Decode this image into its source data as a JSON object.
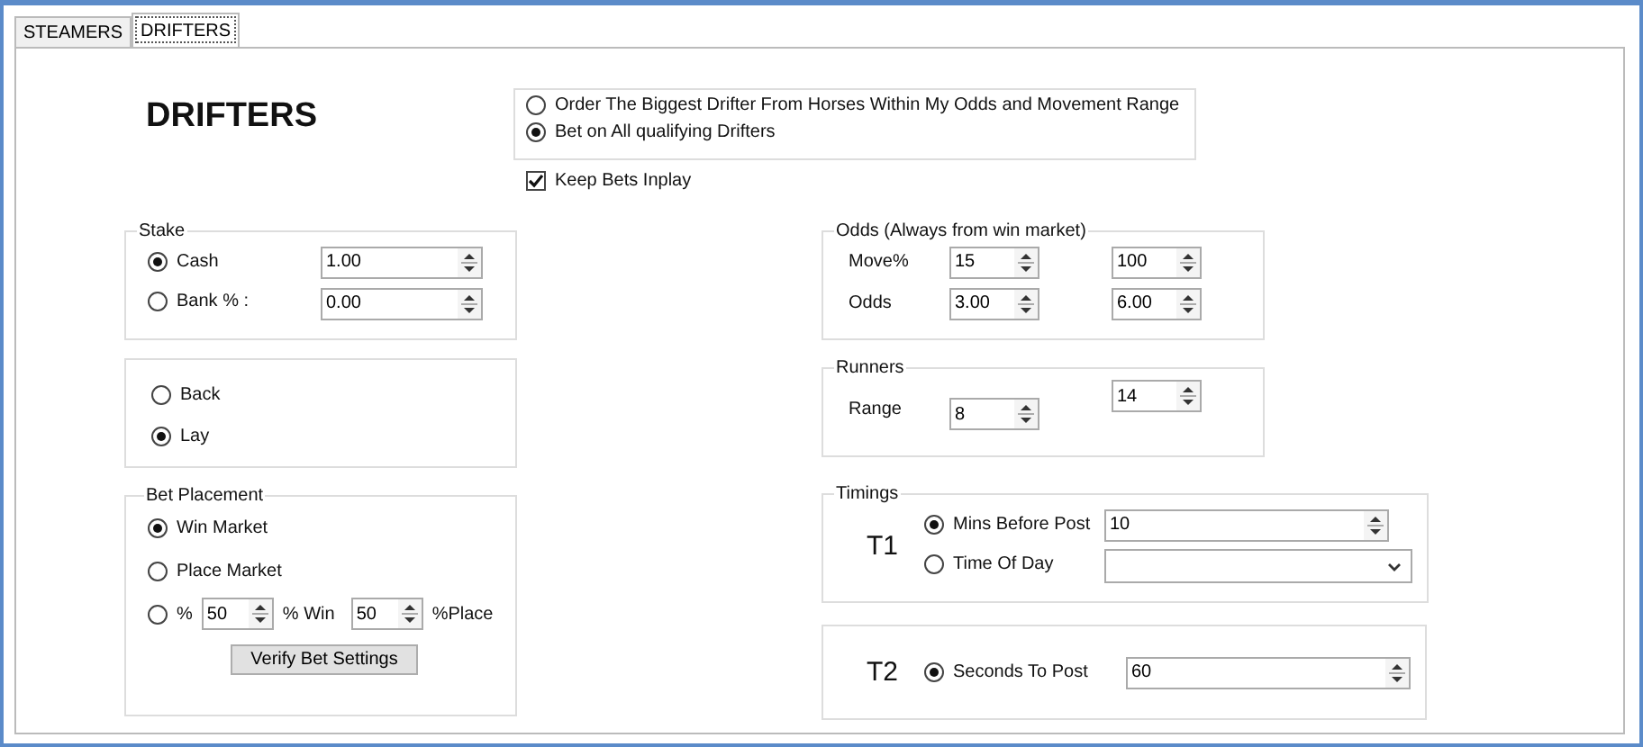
{
  "tabs": [
    {
      "label": "STEAMERS",
      "selected": false
    },
    {
      "label": "DRIFTERS",
      "selected": true
    }
  ],
  "title": "DRIFTERS",
  "mode_options": [
    {
      "label": "Order The Biggest Drifter From Horses Within My Odds and Movement Range",
      "selected": false
    },
    {
      "label": "Bet on All qualifying Drifters",
      "selected": true
    }
  ],
  "keep_bets_inplay": {
    "label": "Keep Bets Inplay",
    "checked": true
  },
  "stake": {
    "title": "Stake",
    "options": [
      {
        "label": "Cash",
        "selected": true,
        "value": "1.00"
      },
      {
        "label": "Bank % :",
        "selected": false,
        "value": "0.00"
      }
    ]
  },
  "direction": [
    {
      "label": "Back",
      "selected": false
    },
    {
      "label": "Lay",
      "selected": true
    }
  ],
  "bet_placement": {
    "title": "Bet Placement",
    "options": [
      {
        "kind": "radio",
        "label": "Win Market",
        "selected": true
      },
      {
        "kind": "radio",
        "label": "Place Market",
        "selected": false
      },
      {
        "kind": "split",
        "label": "%",
        "selected": false,
        "win_value": "50",
        "win_label": "% Win",
        "place_value": "50",
        "place_label": "%Place"
      }
    ],
    "button": "Verify Bet Settings"
  },
  "odds": {
    "title": "Odds (Always from win market)",
    "rows": [
      {
        "label": "Move%",
        "min": "15",
        "max": "100"
      },
      {
        "label": "Odds",
        "min": "3.00",
        "max": "6.00"
      }
    ]
  },
  "runners": {
    "title": "Runners",
    "rows": [
      {
        "label": "Range",
        "min": "8",
        "max": "14"
      }
    ]
  },
  "timings": {
    "title": "Timings",
    "label": "T1",
    "options": [
      {
        "kind": "spin",
        "label": "Mins Before Post",
        "selected": true,
        "value": "10"
      },
      {
        "kind": "dropdown",
        "label": "Time Of Day",
        "selected": false
      }
    ]
  },
  "t2": {
    "label": "T2",
    "options": [
      {
        "kind": "spin",
        "label": "Seconds To Post",
        "selected": true,
        "value": "60"
      }
    ]
  }
}
